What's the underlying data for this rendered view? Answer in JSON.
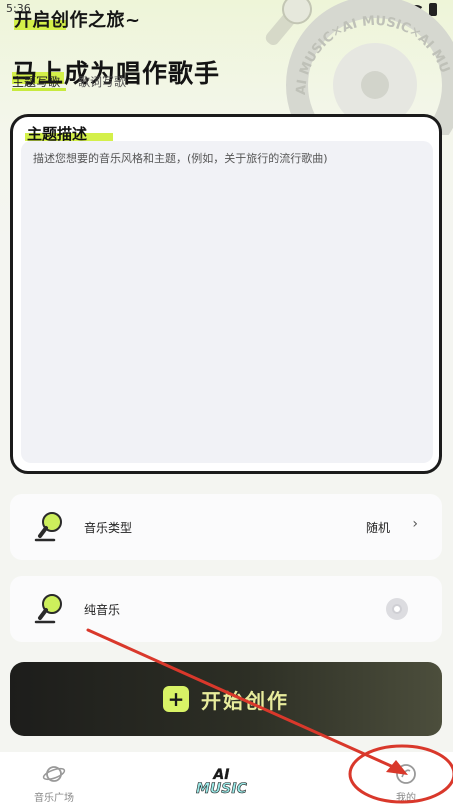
{
  "status_bar": {
    "time": "5:36"
  },
  "hero": {
    "subtitle": "开启创作之旅~",
    "title": "马上成为唱作歌手",
    "deco_ring_text": "AI MUSIC✕AI MUSIC✕AI MU"
  },
  "tabs": [
    {
      "label": "主题写歌",
      "active": true
    },
    {
      "label": "歌词写歌",
      "active": false
    }
  ],
  "description": {
    "title": "主题描述",
    "placeholder": "描述您想要的音乐风格和主题，(例如，关于旅行的流行歌曲)"
  },
  "options": {
    "music_type": {
      "label": "音乐类型",
      "value": "随机",
      "icon": "mic-icon"
    },
    "pure_music": {
      "label": "纯音乐",
      "icon": "mic-icon",
      "enabled": false
    }
  },
  "start_button": {
    "label": "开始创作",
    "icon": "plus-icon"
  },
  "bottom_nav": {
    "items": [
      {
        "label": "音乐广场",
        "icon": "planet-icon"
      },
      {
        "label": "我的",
        "icon": "profile-icon"
      }
    ],
    "center_logo": {
      "line1": "AI",
      "line2": "MUSIC"
    }
  },
  "colors": {
    "accent_lime": "#d4f04a",
    "dark": "#1b1b1b",
    "annotation_red": "#d9382b"
  }
}
